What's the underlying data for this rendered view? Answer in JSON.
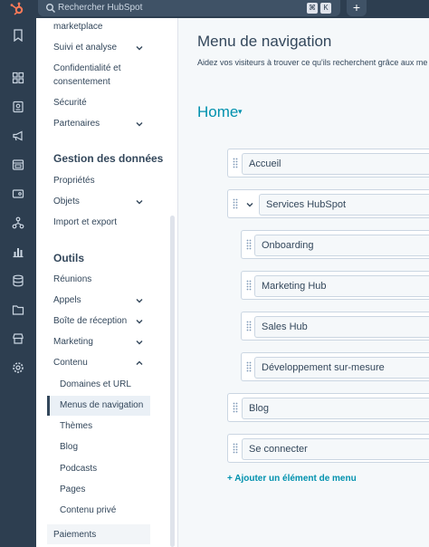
{
  "topbar": {
    "search_placeholder": "Rechercher HubSpot",
    "shortcut_keys": [
      "⌘",
      "K"
    ],
    "add_label": "+"
  },
  "rail": {
    "icons": [
      "hubspot-logo",
      "bookmark-icon",
      "grid-icon",
      "contacts-icon",
      "megaphone-icon",
      "content-icon",
      "commerce-icon",
      "workflow-icon",
      "reports-icon",
      "database-icon",
      "folder-icon",
      "store-icon",
      "settings-icon"
    ]
  },
  "sidebar": {
    "items_top": [
      {
        "label": "marketplace",
        "has_chevron": false
      },
      {
        "label": "Suivi et analyse",
        "has_chevron": true
      },
      {
        "label": "Confidentialité et consentement",
        "has_chevron": false
      },
      {
        "label": "Sécurité",
        "has_chevron": false
      },
      {
        "label": "Partenaires",
        "has_chevron": true
      }
    ],
    "section_data": {
      "title": "Gestion des données",
      "items": [
        {
          "label": "Propriétés",
          "has_chevron": false
        },
        {
          "label": "Objets",
          "has_chevron": true
        },
        {
          "label": "Import et export",
          "has_chevron": false
        }
      ]
    },
    "section_tools": {
      "title": "Outils",
      "items": [
        {
          "label": "Réunions",
          "has_chevron": false
        },
        {
          "label": "Appels",
          "has_chevron": true
        },
        {
          "label": "Boîte de réception",
          "has_chevron": true
        },
        {
          "label": "Marketing",
          "has_chevron": true
        },
        {
          "label": "Contenu",
          "has_chevron": true,
          "expanded": true
        }
      ]
    },
    "content_children": [
      "Domaines et URL",
      "Menus de navigation",
      "Thèmes",
      "Blog",
      "Podcasts",
      "Pages",
      "Contenu privé"
    ],
    "active_child": "Menus de navigation",
    "last_item": "Paiements"
  },
  "main": {
    "title": "Menu de navigation",
    "description": "Aidez vos visiteurs à trouver ce qu'ils recherchent grâce aux me",
    "menu_name": "Home",
    "menu_caret": "▾",
    "menu_items": [
      {
        "label": "Accueil",
        "level": 0,
        "has_toggle": false
      },
      {
        "label": "Services HubSpot",
        "level": 0,
        "has_toggle": true,
        "expanded": true
      },
      {
        "label": "Onboarding",
        "level": 1,
        "has_toggle": false
      },
      {
        "label": "Marketing Hub",
        "level": 1,
        "has_toggle": false
      },
      {
        "label": "Sales Hub",
        "level": 1,
        "has_toggle": false
      },
      {
        "label": "Développement sur-mesure",
        "level": 1,
        "has_toggle": false
      },
      {
        "label": "Blog",
        "level": 0,
        "has_toggle": false
      },
      {
        "label": "Se connecter",
        "level": 0,
        "has_toggle": false
      }
    ],
    "add_item_label": "+ Ajouter un élément de menu"
  },
  "colors": {
    "nav_dark": "#2d3e50",
    "link": "#0091ae",
    "text": "#33475b",
    "border": "#cbd6e2"
  }
}
